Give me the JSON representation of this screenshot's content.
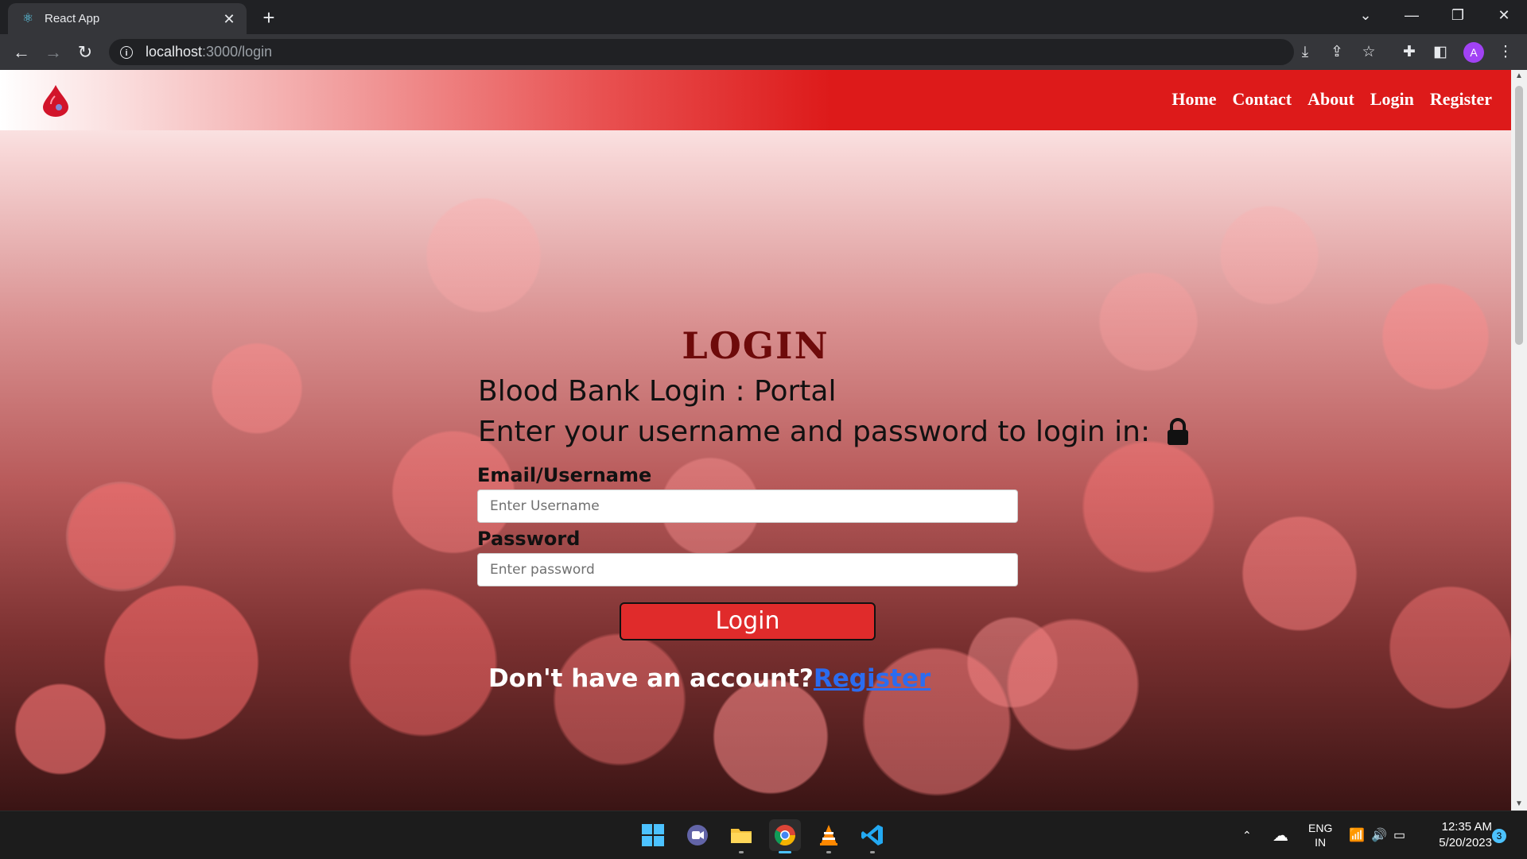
{
  "browser": {
    "tab_title": "React App",
    "url_host": "localhost",
    "url_path": ":3000/login",
    "profile_initial": "A"
  },
  "site": {
    "nav": [
      "Home",
      "Contact",
      "About",
      "Login",
      "Register"
    ]
  },
  "login": {
    "title": "LOGIN",
    "subtitle": "Blood Bank Login : Portal",
    "instructions": "Enter your username and password to login in:",
    "email_label": "Email/Username",
    "email_placeholder": "Enter Username",
    "password_label": "Password",
    "password_placeholder": "Enter password",
    "button": "Login",
    "no_account": "Don't have an account?",
    "register_link": "Register"
  },
  "taskbar": {
    "lang_top": "ENG",
    "lang_bottom": "IN",
    "time": "12:35 AM",
    "date": "5/20/2023",
    "notifications": "3"
  },
  "colors": {
    "brand_red": "#dd1a1a",
    "title_red": "#6e0a0a",
    "link_blue": "#2b6cf0"
  }
}
